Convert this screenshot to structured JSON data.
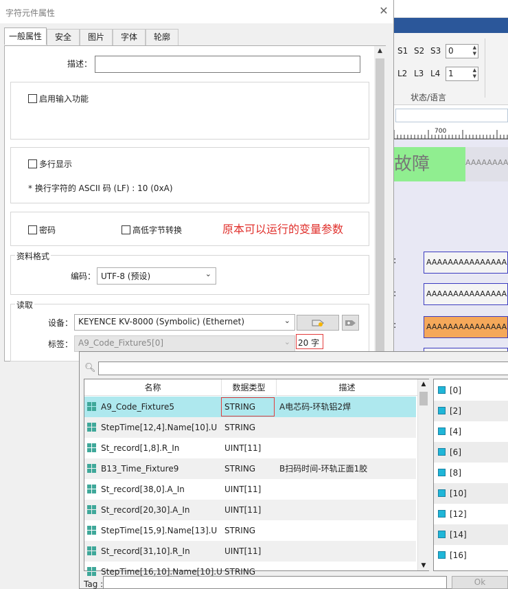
{
  "background": {
    "ribbon": {
      "s1": "S1",
      "s2": "S2",
      "s3": "S3",
      "s_value": "0",
      "l2": "L2",
      "l3": "L3",
      "l4": "L4",
      "l_value": "1",
      "group_label": "状态/语言"
    },
    "ruler_label": "700",
    "fault_text": "故障",
    "fault_placeholder": "AAAAAAAA",
    "field_text": "AAAAAAAAAAAAAAAAAA",
    "colon": ":"
  },
  "dialog": {
    "title": "字符元件属性",
    "close": "✕",
    "tabs": [
      "一般属性",
      "安全",
      "图片",
      "字体",
      "轮廓"
    ],
    "description_label": "描述：",
    "description_value": "",
    "enable_input_label": "启用输入功能",
    "multiline_label": "多行显示",
    "linefeed_note": "* 换行字符的 ASCII 码 (LF) : 10 (0xA)",
    "password_label": "密码",
    "byte_swap_label": "高低字节转换",
    "annotation": "原本可以运行的变量参数",
    "data_format_label": "资料格式",
    "encoding_label": "编码：",
    "encoding_value": "UTF-8 (预设)",
    "read_label": "读取",
    "device_label": "设备：",
    "device_value": "KEYENCE KV-8000 (Symbolic) (Ethernet)",
    "tag_label": "标签：",
    "tag_value": "A9_Code_Fixture5[0]",
    "length_value": "20 字"
  },
  "browser": {
    "search_placeholder": "",
    "columns": [
      "名称",
      "数据类型",
      "描述"
    ],
    "rows": [
      {
        "name": "A9_Code_Fixture5",
        "type": "STRING",
        "desc": "A电芯码-环轨铝2焊"
      },
      {
        "name": "StepTime[12,4].Name[10].U",
        "type": "STRING",
        "desc": ""
      },
      {
        "name": "St_record[1,8].R_In",
        "type": "UINT[11]",
        "desc": ""
      },
      {
        "name": "B13_Time_Fixture9",
        "type": "STRING",
        "desc": "B扫码时间-环轨正面1胶"
      },
      {
        "name": "St_record[38,0].A_In",
        "type": "UINT[11]",
        "desc": ""
      },
      {
        "name": "St_record[20,30].A_In",
        "type": "UINT[11]",
        "desc": ""
      },
      {
        "name": "StepTime[15,9].Name[13].U",
        "type": "STRING",
        "desc": ""
      },
      {
        "name": "St_record[31,10].R_In",
        "type": "UINT[11]",
        "desc": ""
      },
      {
        "name": "StepTime[16,10].Name[10].U",
        "type": "STRING",
        "desc": ""
      }
    ],
    "indices": [
      "[0]",
      "[2]",
      "[4]",
      "[6]",
      "[8]",
      "[10]",
      "[12]",
      "[14]",
      "[16]"
    ],
    "tag_label": "Tag :",
    "tag_value": "",
    "ok_label": "Ok"
  }
}
